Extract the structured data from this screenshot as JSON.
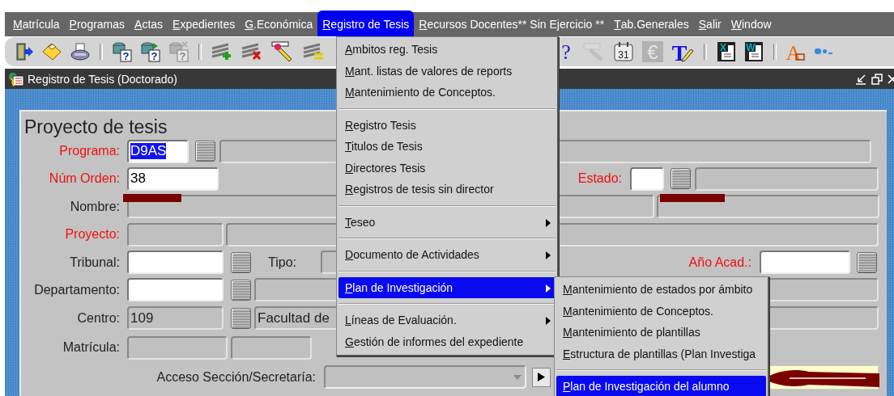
{
  "menubar": [
    {
      "label": "Matrícula",
      "underlined_initial": true,
      "selected": false
    },
    {
      "label": "Programas",
      "underlined_initial": true,
      "selected": false
    },
    {
      "label": "Actas",
      "underlined_initial": true,
      "selected": false
    },
    {
      "label": "Expedientes",
      "underlined_initial": true,
      "selected": false
    },
    {
      "label": "G.Económica",
      "underlined_initial": true,
      "selected": false
    },
    {
      "label": "Registro de Tesis",
      "underlined_initial": true,
      "selected": true
    },
    {
      "label": "Recursos Docentes** Sin Ejercicio **",
      "underlined_initial": true,
      "selected": false
    },
    {
      "label": "Tab.Generales",
      "underlined_initial": true,
      "selected": false
    },
    {
      "label": "Salir",
      "underlined_initial": true,
      "selected": false
    },
    {
      "label": "Window",
      "underlined_initial": true,
      "selected": false
    }
  ],
  "toolbar": {
    "left": [
      {
        "kind": "exit",
        "disabled": false
      },
      {
        "kind": "save",
        "disabled": false
      },
      {
        "kind": "print",
        "disabled": false
      },
      {
        "kind": "separator"
      },
      {
        "kind": "query",
        "glyph": "?",
        "disabled": false
      },
      {
        "kind": "execute-query",
        "glyph": "?",
        "disabled": false
      },
      {
        "kind": "cancel-query",
        "glyph": "?",
        "disabled": true
      },
      {
        "kind": "separator"
      },
      {
        "kind": "insert",
        "disabled": false
      },
      {
        "kind": "delete",
        "disabled": false
      },
      {
        "kind": "clear",
        "disabled": false
      },
      {
        "kind": "list",
        "disabled": false
      }
    ],
    "right": [
      {
        "kind": "help",
        "glyph": "?",
        "disabled": false
      },
      {
        "kind": "search",
        "disabled": true
      },
      {
        "kind": "calendar",
        "glyph": "31",
        "disabled": false
      },
      {
        "kind": "euro",
        "glyph": "€",
        "disabled": true
      },
      {
        "kind": "edit-text",
        "glyph": "T",
        "disabled": false
      },
      {
        "kind": "separator"
      },
      {
        "kind": "doc",
        "glyph": "X",
        "disabled": false
      },
      {
        "kind": "doc",
        "glyph": "W",
        "disabled": false
      },
      {
        "kind": "separator"
      },
      {
        "kind": "font",
        "glyph": "A",
        "disabled": false
      },
      {
        "kind": "dots",
        "disabled": false
      }
    ]
  },
  "window": {
    "title": "Registro de Tesis (Doctorado)"
  },
  "form": {
    "title": "Proyecto de tesis",
    "rows": [
      {
        "items": [
          {
            "kind": "label",
            "text": "Programa:",
            "required": true
          },
          {
            "kind": "field",
            "value": "D9AS",
            "editable": true,
            "highlighted": true
          },
          {
            "kind": "lov"
          },
          {
            "kind": "field",
            "editable": false
          }
        ]
      },
      {
        "items": [
          {
            "kind": "label",
            "text": "Núm Orden:",
            "required": true
          },
          {
            "kind": "field",
            "value": "38",
            "editable": true,
            "highlighted": false
          },
          {
            "kind": "label",
            "text": "Estado:",
            "required": true
          },
          {
            "kind": "field",
            "editable": true
          },
          {
            "kind": "lov"
          },
          {
            "kind": "field",
            "editable": false
          }
        ]
      },
      {
        "items": [
          {
            "kind": "label",
            "text": "Nombre:",
            "required": false
          },
          {
            "kind": "field",
            "editable": false,
            "redacted": true
          },
          {
            "kind": "field",
            "editable": false,
            "redacted": true
          }
        ]
      },
      {
        "items": [
          {
            "kind": "label",
            "text": "Proyecto:",
            "required": true
          },
          {
            "kind": "field",
            "editable": false
          },
          {
            "kind": "field",
            "editable": false
          }
        ]
      },
      {
        "items": [
          {
            "kind": "label",
            "text": "Tribunal:",
            "required": false
          },
          {
            "kind": "field",
            "editable": true
          },
          {
            "kind": "lov"
          },
          {
            "kind": "label",
            "text": "Tipo:",
            "required": false
          },
          {
            "kind": "field",
            "editable": false
          },
          {
            "kind": "label",
            "text": "Año Acad.:",
            "required": true
          },
          {
            "kind": "field",
            "editable": true
          },
          {
            "kind": "lov"
          }
        ]
      },
      {
        "items": [
          {
            "kind": "label",
            "text": "Departamento:",
            "required": false
          },
          {
            "kind": "field",
            "editable": true
          },
          {
            "kind": "lov"
          },
          {
            "kind": "field",
            "editable": false
          }
        ]
      },
      {
        "items": [
          {
            "kind": "label",
            "text": "Centro:",
            "required": false
          },
          {
            "kind": "field",
            "value": "109",
            "editable": false
          },
          {
            "kind": "lov"
          },
          {
            "kind": "field",
            "value": "Facultad de",
            "editable": false
          }
        ]
      },
      {
        "items": [
          {
            "kind": "label",
            "text": "Matrícula:",
            "required": false
          },
          {
            "kind": "field",
            "editable": false
          },
          {
            "kind": "field",
            "editable": false
          }
        ]
      },
      {
        "items": [
          {
            "kind": "label",
            "text": "Acceso Sección/Secretaría:",
            "required": false
          },
          {
            "kind": "dropdown"
          },
          {
            "kind": "play"
          },
          {
            "kind": "button",
            "annotated": true
          }
        ]
      }
    ]
  },
  "dropdown": {
    "items": [
      {
        "kind": "item",
        "label": "Ambitos reg. Tesis",
        "underlined_initial": true,
        "selected": false
      },
      {
        "kind": "item",
        "label": "Mant. listas de valores de reports",
        "underlined_initial": true,
        "selected": false
      },
      {
        "kind": "item",
        "label": "Mantenimiento de Conceptos.",
        "underlined_initial": true,
        "selected": false
      },
      {
        "kind": "separator"
      },
      {
        "kind": "item",
        "label": "Registro Tesis",
        "underlined_initial": true,
        "selected": false
      },
      {
        "kind": "item",
        "label": "Titulos de Tesis",
        "underlined_initial": true,
        "selected": false
      },
      {
        "kind": "item",
        "label": "Directores Tesis",
        "underlined_initial": true,
        "selected": false
      },
      {
        "kind": "item",
        "label": "Registros de tesis sin director",
        "underlined_initial": true,
        "selected": false
      },
      {
        "kind": "separator"
      },
      {
        "kind": "item",
        "label": "Teseo",
        "underlined_initial": true,
        "selected": false,
        "submenu": true
      },
      {
        "kind": "separator"
      },
      {
        "kind": "item",
        "label": "Documento de Actividades",
        "underlined_initial": true,
        "selected": false,
        "submenu": true
      },
      {
        "kind": "separator"
      },
      {
        "kind": "item",
        "label": "Plan de Investigación",
        "underlined_initial": true,
        "selected": true,
        "submenu": true
      },
      {
        "kind": "separator"
      },
      {
        "kind": "item",
        "label": "Líneas de Evaluación.",
        "underlined_initial": true,
        "selected": false,
        "submenu": true
      },
      {
        "kind": "item",
        "label": "Gestión de informes del expediente",
        "underlined_initial": true,
        "selected": false
      }
    ]
  },
  "submenu": {
    "items": [
      {
        "kind": "item",
        "label": "Mantenimiento de estados por ámbito",
        "underlined_initial": true,
        "selected": false
      },
      {
        "kind": "item",
        "label": "Mantenimiento de Conceptos.",
        "underlined_initial": true,
        "selected": false
      },
      {
        "kind": "item",
        "label": "Mantenimiento de plantillas",
        "underlined_initial": true,
        "selected": false
      },
      {
        "kind": "item",
        "label": "Estructura de plantillas (Plan Investiga",
        "underlined_initial": true,
        "selected": false
      },
      {
        "kind": "separator"
      },
      {
        "kind": "item",
        "label": "Plan de Investigación del alumno",
        "underlined_initial": true,
        "selected": true
      }
    ]
  }
}
